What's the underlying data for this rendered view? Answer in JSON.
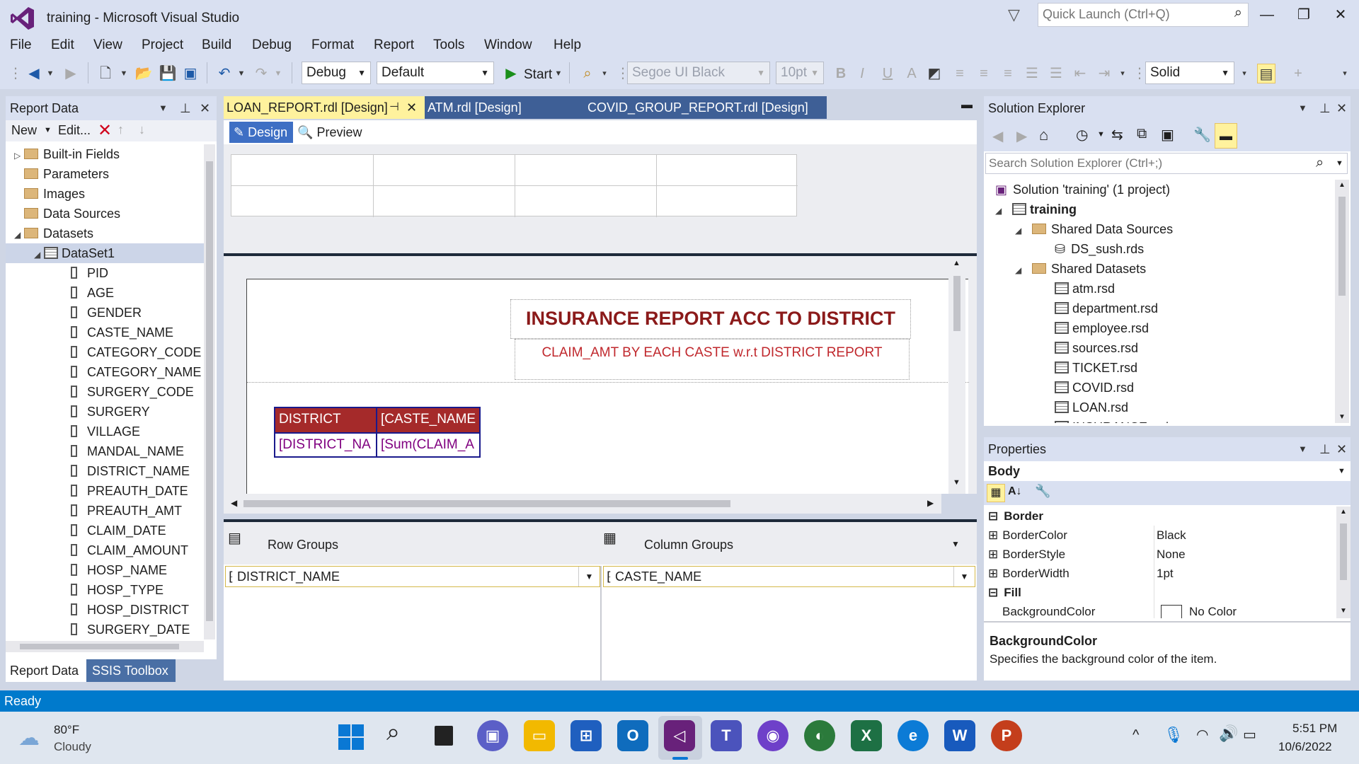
{
  "window": {
    "title": "training - Microsoft Visual Studio",
    "quick_launch_placeholder": "Quick Launch (Ctrl+Q)"
  },
  "menu": [
    "File",
    "Edit",
    "View",
    "Project",
    "Build",
    "Debug",
    "Format",
    "Report",
    "Tools",
    "Window",
    "Help"
  ],
  "toolbar": {
    "config": "Debug",
    "platform": "Default",
    "start_label": "Start",
    "font_name": "Segoe UI Black",
    "font_size": "10pt",
    "border_style": "Solid"
  },
  "report_data": {
    "title": "Report Data",
    "new_label": "New",
    "edit_label": "Edit...",
    "folders": [
      "Built-in Fields",
      "Parameters",
      "Images",
      "Data Sources",
      "Datasets"
    ],
    "dataset": "DataSet1",
    "fields": [
      "PID",
      "AGE",
      "GENDER",
      "CASTE_NAME",
      "CATEGORY_CODE",
      "CATEGORY_NAME",
      "SURGERY_CODE",
      "SURGERY",
      "VILLAGE",
      "MANDAL_NAME",
      "DISTRICT_NAME",
      "PREAUTH_DATE",
      "PREAUTH_AMT",
      "CLAIM_DATE",
      "CLAIM_AMOUNT",
      "HOSP_NAME",
      "HOSP_TYPE",
      "HOSP_DISTRICT",
      "SURGERY_DATE"
    ],
    "bottom_tabs": [
      "Report Data",
      "SSIS Toolbox"
    ]
  },
  "doc_tabs": [
    "LOAN_REPORT.rdl [Design]",
    "ATM.rdl [Design]",
    "COVID_GROUP_REPORT.rdl [Design]"
  ],
  "designer": {
    "design_label": "Design",
    "preview_label": "Preview",
    "report_title": "INSURANCE REPORT ACC TO DISTRICT",
    "report_subtitle": "CLAIM_AMT BY EACH CASTE w.r.t DISTRICT REPORT",
    "matrix": {
      "header": [
        "DISTRICT",
        "[CASTE_NAME"
      ],
      "body": [
        "[DISTRICT_NA",
        "[Sum(CLAIM_A"
      ]
    }
  },
  "groups": {
    "row_label": "Row Groups",
    "col_label": "Column Groups",
    "row_group": "DISTRICT_NAME",
    "col_group": "CASTE_NAME"
  },
  "solution_explorer": {
    "title": "Solution Explorer",
    "search_placeholder": "Search Solution Explorer (Ctrl+;)",
    "solution": "Solution 'training' (1 project)",
    "project": "training",
    "shared_data_sources": "Shared Data Sources",
    "data_sources": [
      "DS_sush.rds"
    ],
    "shared_datasets": "Shared Datasets",
    "datasets": [
      "atm.rsd",
      "department.rsd",
      "employee.rsd",
      "sources.rsd",
      "TICKET.rsd",
      "COVID.rsd",
      "LOAN.rsd",
      "INSURANCE.rsd"
    ]
  },
  "properties": {
    "title": "Properties",
    "object": "Body",
    "category_border": "Border",
    "category_fill": "Fill",
    "rows": [
      {
        "name": "BorderColor",
        "value": "Black"
      },
      {
        "name": "BorderStyle",
        "value": "None"
      },
      {
        "name": "BorderWidth",
        "value": "1pt"
      }
    ],
    "fill_row": {
      "name": "BackgroundColor",
      "value": "No Color"
    },
    "desc_title": "BackgroundColor",
    "desc_text": "Specifies the background color of the item."
  },
  "status": "Ready",
  "taskbar": {
    "weather_temp": "80°F",
    "weather_desc": "Cloudy",
    "time": "5:51 PM",
    "date": "10/6/2022"
  },
  "colors": {
    "accent": "#007acc",
    "report_red": "#a52a2a",
    "title_red": "#8b1a1a",
    "matrix_purple": "#800080",
    "tab_yellow": "#fff29d"
  }
}
